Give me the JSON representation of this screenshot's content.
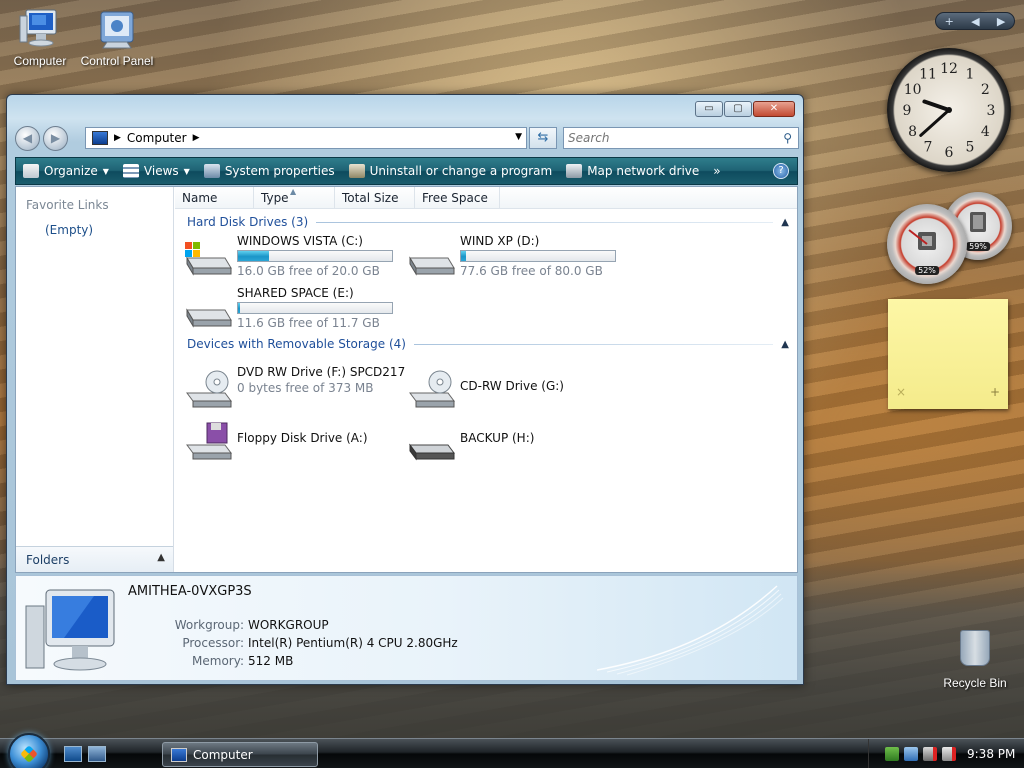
{
  "desktop": {
    "icons": [
      {
        "label": "Computer"
      },
      {
        "label": "Control Panel"
      }
    ],
    "recycle_bin": "Recycle Bin"
  },
  "gadgets": {
    "clock": {
      "numbers": [
        "12",
        "1",
        "2",
        "3",
        "4",
        "5",
        "6",
        "7",
        "8",
        "9",
        "10",
        "11"
      ],
      "time_hours": 9,
      "time_minutes": 38
    },
    "cpu_meter": {
      "cpu_percent": "52%",
      "memory_percent": "59%"
    },
    "sticky_note": {
      "delete": "×",
      "add": "+"
    },
    "sidebar_controls": {
      "add": "+",
      "prev": "◀",
      "next": "▶"
    }
  },
  "window": {
    "title": "Computer",
    "caption_buttons": {
      "minimize": "▭",
      "maximize": "▢",
      "close": "✕"
    },
    "address": {
      "root_icon": "computer-icon",
      "path": "Computer"
    },
    "search": {
      "placeholder": "Search",
      "value": ""
    },
    "toolbar": {
      "organize": "Organize",
      "views": "Views",
      "system_properties": "System properties",
      "uninstall": "Uninstall or change a program",
      "map_drive": "Map network drive",
      "more": "»",
      "help": "?"
    },
    "nav_pane": {
      "favorite_links": "Favorite Links",
      "empty": "(Empty)",
      "folders": "Folders"
    },
    "columns": [
      "Name",
      "Type",
      "Total Size",
      "Free Space"
    ],
    "groups": {
      "hard_disks": "Hard Disk Drives (3)",
      "removable": "Devices with Removable Storage (4)"
    },
    "hard_disks": [
      {
        "name": "WINDOWS VISTA (C:)",
        "free": "16.0 GB free of 20.0 GB",
        "used_fraction": 0.2
      },
      {
        "name": "WIND XP (D:)",
        "free": "77.6 GB free of 80.0 GB",
        "used_fraction": 0.03
      },
      {
        "name": "SHARED SPACE (E:)",
        "free": "11.6 GB free of 11.7 GB",
        "used_fraction": 0.01
      }
    ],
    "removable": [
      {
        "name": "DVD RW Drive (F:) SPCD217",
        "free": "0 bytes free of 373 MB"
      },
      {
        "name": "CD-RW Drive (G:)"
      },
      {
        "name": "Floppy Disk Drive (A:)"
      },
      {
        "name": "BACKUP (H:)"
      }
    ],
    "details": {
      "computer_name": "AMITHEA-0VXGP3S",
      "workgroup_label": "Workgroup:",
      "workgroup": "WORKGROUP",
      "processor_label": "Processor:",
      "processor": "Intel(R) Pentium(R) 4 CPU 2.80GHz",
      "memory_label": "Memory:",
      "memory": "512 MB"
    }
  },
  "taskbar": {
    "task": "Computer",
    "time": "9:38 PM"
  },
  "colors": {
    "toolbar": "#1f6374",
    "group_text": "#1f4f9a",
    "bar_fill": "#1b95c8"
  }
}
